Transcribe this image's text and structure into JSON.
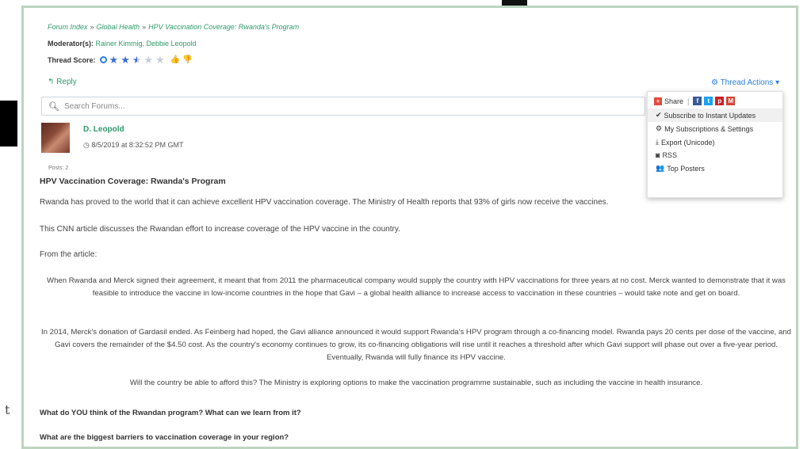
{
  "breadcrumb": {
    "items": [
      "Forum Index",
      "Global Health",
      "HPV Vaccination Coverage: Rwanda's Program"
    ],
    "separator": "»"
  },
  "moderators": {
    "label": "Moderator(s):",
    "names": "Rainer Kimmig, Debbie Leopold"
  },
  "thread_score": {
    "label": "Thread Score:",
    "rating": 2.5,
    "max": 5
  },
  "actions": {
    "reply_label": "Reply",
    "thread_actions_label": "Thread Actions"
  },
  "search": {
    "placeholder": "Search Forums..."
  },
  "dropdown": {
    "share_label": "Share",
    "items": [
      {
        "label": "Subscribe to Instant Updates",
        "icon": "check-circle-icon",
        "active": true
      },
      {
        "label": "My Subscriptions & Settings",
        "icon": "gear-icon",
        "active": false
      },
      {
        "label": "Export (Unicode)",
        "icon": "download-icon",
        "active": false
      },
      {
        "label": "RSS",
        "icon": "rss-icon",
        "active": false
      },
      {
        "label": "Top Posters",
        "icon": "users-icon",
        "active": false
      }
    ]
  },
  "post": {
    "author": "D. Leopold",
    "date": "8/5/2019 at 8:32:52 PM GMT",
    "posts_count": "Posts: 2",
    "title": "HPV Vaccination Coverage: Rwanda's Program",
    "intro": "Rwanda has proved to the world that it can achieve excellent HPV vaccination coverage. The Ministry of Health reports that 93% of girls now receive the vaccines.",
    "link_text": "This CNN article discusses the Rwandan effort to increase coverage of the HPV vaccine in the country.",
    "from_article": "From the article:",
    "quote1": "When Rwanda and Merck signed their agreement, it meant that from 2011 the pharmaceutical company would supply the country with HPV vaccinations for three years at no cost. Merck wanted to demonstrate that it was feasible to introduce the vaccine in low-income countries in the hope that Gavi – a global health alliance to increase access to vaccination in these countries – would take note and get on board.",
    "quote2": "In 2014, Merck's donation of Gardasil ended. As Feinberg had hoped, the Gavi alliance announced it would support Rwanda's HPV program through a co-financing model. Rwanda pays 20 cents per dose of the vaccine, and Gavi covers the remainder of the $4.50 cost. As the country's economy continues to grow, its co-financing obligations will rise until it reaches a threshold after which Gavi support will phase out over a five-year period. Eventually, Rwanda will fully finance its HPV vaccine.",
    "quote3": "Will the country be able to afford this? The Ministry is exploring options to make the vaccination programme sustainable, such as including the vaccine in health insurance.",
    "question1": "What do YOU think of the Rwandan program? What can we learn from it?",
    "question2": "What are the biggest barriers to vaccination coverage in your region?"
  },
  "colors": {
    "link_green": "#2e9a6b",
    "accent_blue": "#2b7de0",
    "frame_border": "#bcd4c0"
  }
}
